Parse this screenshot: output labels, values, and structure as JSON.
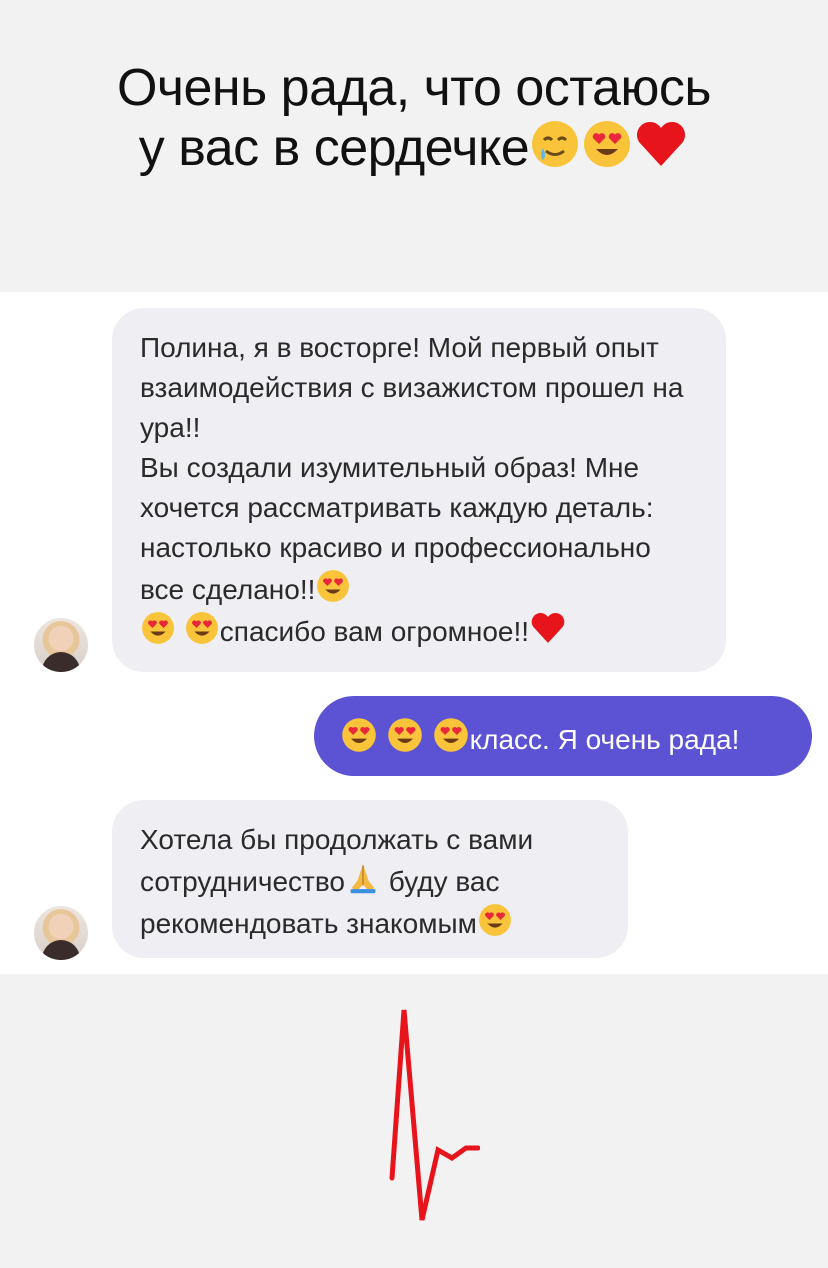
{
  "caption": {
    "line1": "Очень рада, что остаюсь",
    "line2": "у вас в сердечке",
    "line2_emojis": [
      "smiling-face-with-tear-icon",
      "heart-eyes-icon",
      "red-heart-icon"
    ]
  },
  "messages": [
    {
      "direction": "incoming",
      "paragraphs": [
        "Полина, я в восторге! Мой первый опыт взаимодействия с визажистом прошел на ура!!",
        "Вы создали изумительный образ! Мне хочется рассматривать каждую деталь: настолько красиво и профессионально все сделано!!"
      ],
      "tail_text": "спасибо вам огромное!!"
    },
    {
      "direction": "outgoing",
      "text": "класс. Я очень рада!"
    },
    {
      "direction": "incoming",
      "text_part1": "Хотела бы продолжать с вами сотрудничество",
      "text_part2": "буду вас рекомендовать знакомым"
    }
  ],
  "colors": {
    "caption_bg": "#f2f2f2",
    "incoming_bubble": "#efeef3",
    "outgoing_bubble": "#5b52d4",
    "pulse": "#e8141c"
  }
}
